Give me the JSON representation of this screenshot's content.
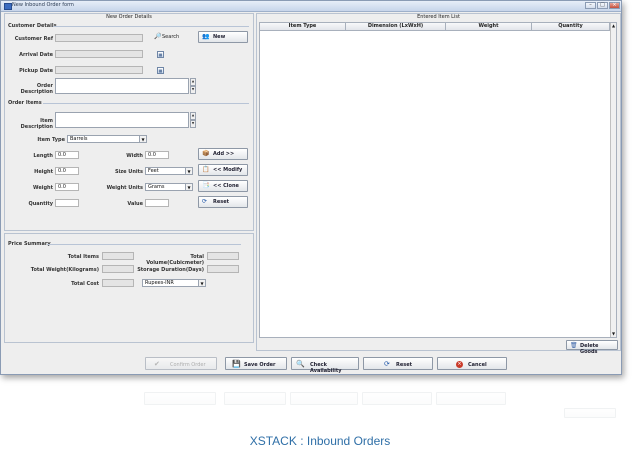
{
  "window": {
    "title": "New Inbound Order form"
  },
  "left_panel": {
    "title": "New Order Details"
  },
  "right_panel": {
    "title": "Entered Item List"
  },
  "customer": {
    "section": "Customer Details",
    "ref_label": "Customer Ref",
    "search_label": "Search",
    "new_label": "New",
    "arrival_label": "Arrival Date",
    "pickup_label": "Pickup Date",
    "desc_label": "Order Description"
  },
  "items": {
    "section": "Order Items",
    "desc_label": "Item Description",
    "type_label": "Item Type",
    "type_value": "Barrels",
    "length_label": "Length",
    "length_value": "0.0",
    "width_label": "Width",
    "width_value": "0.0",
    "height_label": "Height",
    "height_value": "0.0",
    "size_units_label": "Size Units",
    "size_units_value": "Feet",
    "weight_label": "Weight",
    "weight_value": "0.0",
    "weight_units_label": "Weight Units",
    "weight_units_value": "Grams",
    "quantity_label": "Quantity",
    "value_label": "Value",
    "add_label": "Add >>",
    "modify_label": "<< Modify",
    "clone_label": "<< Clone",
    "reset_label": "Reset"
  },
  "price": {
    "section": "Price Summary",
    "total_items_label": "Total Items",
    "total_volume_label": "Total Volume(Cubicmeter)",
    "total_weight_label": "Total Weight(Kilograms)",
    "storage_label": "Storage Duration(Days)",
    "total_cost_label": "Total Cost",
    "currency_value": "Rupees-INR"
  },
  "table": {
    "columns": [
      "Item Type",
      "Dimension (LxWxH)",
      "Weight",
      "Quantity"
    ]
  },
  "delete_label": "Delete Goods",
  "bottom": {
    "confirm_label": "Confirm Order",
    "save_label": "Save Order",
    "check_label": "Check Availability",
    "reset_label": "Reset",
    "cancel_label": "Cancel"
  },
  "caption": "XSTACK : Inbound Orders"
}
